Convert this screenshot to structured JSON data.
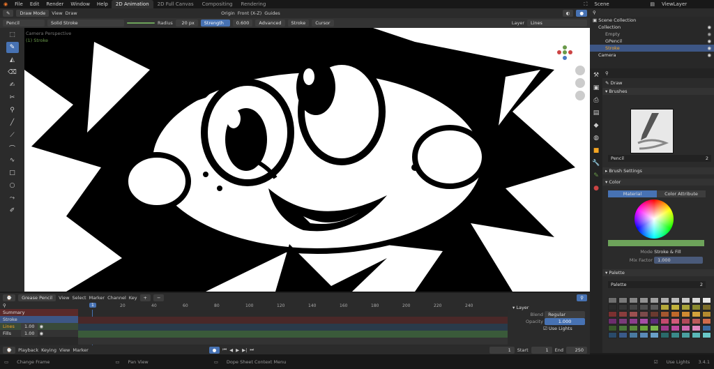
{
  "menu": {
    "items": [
      "File",
      "Edit",
      "Render",
      "Window",
      "Help"
    ],
    "workspaces": [
      "2D Animation",
      "2D Full Canvas",
      "Compositing",
      "Rendering"
    ],
    "scene": "Scene",
    "view_layer": "ViewLayer"
  },
  "viewport_header": {
    "mode": "Draw Mode",
    "view": "View",
    "draw": "Draw",
    "origin": "Origin",
    "front": "Front (X-Z)",
    "guides": "Guides"
  },
  "tool_settings": {
    "brush": "Pencil",
    "stroke_type": "Solid Stroke",
    "radius_label": "Radius",
    "radius_value": "20 px",
    "strength_label": "Strength",
    "strength_value": "0.600",
    "advanced": "Advanced",
    "stroke": "Stroke",
    "cursor": "Cursor",
    "layer_label": "Layer",
    "layer_value": "Lines"
  },
  "viewport_info": {
    "camera": "Camera Perspective",
    "object": "(1) Stroke"
  },
  "outliner": {
    "title": "Scene Collection",
    "items": [
      {
        "name": "Collection",
        "level": 1
      },
      {
        "name": "Empty",
        "level": 2
      },
      {
        "name": "GPencil",
        "level": 2
      },
      {
        "name": "Stroke",
        "level": 2
      },
      {
        "name": "Camera",
        "level": 1
      }
    ]
  },
  "properties": {
    "tool_name": "Draw",
    "brushes_label": "Brushes",
    "brush_name": "Pencil",
    "brush_users": "2",
    "brush_settings": "Brush Settings",
    "color_label": "Color",
    "color_tabs": [
      "Material",
      "Color Attribute"
    ],
    "mode_label": "Mode",
    "mode_value": "Stroke & Fill",
    "mix_label": "Mix Factor",
    "mix_value": "1.000",
    "palette_label": "Palette",
    "palette_name": "Palette",
    "palette_users": "2",
    "use_lights": "Use Lights",
    "swatches": [
      "#6e6e6e",
      "#7a7a7a",
      "#868686",
      "#939393",
      "#a0a0a0",
      "#adadad",
      "#bbbbbb",
      "#c9c9c9",
      "#d8d8d8",
      "#e8e8e8",
      "#2b2b2b",
      "#363636",
      "#444444",
      "#4f4f4f",
      "#5b5b5b",
      "#b4a83a",
      "#c2b23c",
      "#a9a339",
      "#8b8a30",
      "#7e6e2a",
      "#7a3030",
      "#8a3d3d",
      "#9b5050",
      "#7b4a4a",
      "#6a3a2f",
      "#a4572f",
      "#c0692a",
      "#cf8a32",
      "#d4a33c",
      "#b48a2f",
      "#6d2d6d",
      "#7a3b7a",
      "#8c3d8c",
      "#a54da5",
      "#5c2d7a",
      "#c24a6e",
      "#d05a7a",
      "#b04a5a",
      "#bb5b5b",
      "#cf6b4b",
      "#3a5a2a",
      "#4a7a3a",
      "#5a8a3a",
      "#6aa43a",
      "#7bb84a",
      "#a03a8a",
      "#c04aa0",
      "#d06ab0",
      "#e08ac0",
      "#3a6aa0",
      "#2a4a6a",
      "#3a5a8a",
      "#4a7aa0",
      "#5a8ab8",
      "#6aa0c8",
      "#2a6a6a",
      "#3a8a8a",
      "#4aa0a0",
      "#5ab8b8",
      "#6ac8c8"
    ]
  },
  "dopesheet": {
    "mode": "Grease Pencil",
    "menus": [
      "View",
      "Select",
      "Marker",
      "Channel",
      "Key"
    ],
    "current_frame": "1",
    "frames": [
      "20",
      "40",
      "60",
      "80",
      "100",
      "120",
      "140",
      "160",
      "180",
      "200",
      "220",
      "240"
    ],
    "channels": [
      {
        "name": "Summary",
        "opacity": ""
      },
      {
        "name": "Stroke",
        "opacity": ""
      },
      {
        "name": "Lines",
        "opacity": "1.00"
      },
      {
        "name": "Fills",
        "opacity": "1.00"
      }
    ],
    "layer_panel": {
      "title": "Layer",
      "blend_label": "Blend",
      "blend_value": "Regular",
      "opacity_label": "Opacity",
      "opacity_value": "1.000",
      "use_lights": "Use Lights"
    }
  },
  "timeline": {
    "playback": "Playback",
    "keying": "Keying",
    "view": "View",
    "marker": "Marker",
    "frame": "1",
    "start_label": "Start",
    "start": "1",
    "end_label": "End",
    "end": "250"
  },
  "statusbar": {
    "left": "Change Frame",
    "middle": "Pan View",
    "right": "Dope Sheet Context Menu",
    "version": "3.4.1"
  },
  "colors": {
    "accent": "#4772b3",
    "selected": "#3d5685",
    "bg": "#1d1d1d"
  }
}
